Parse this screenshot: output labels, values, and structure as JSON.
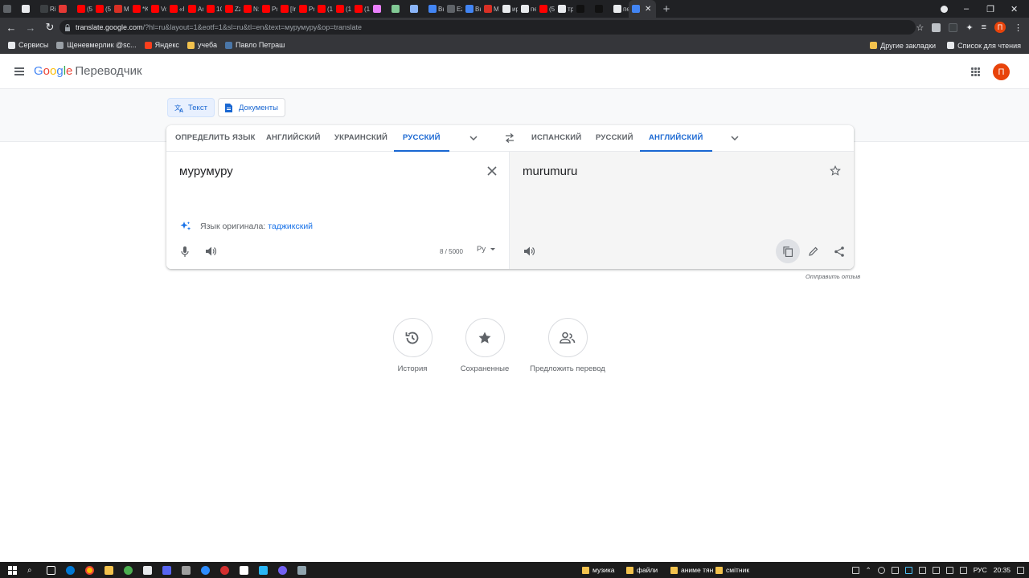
{
  "browser": {
    "tab_labels": [
      "",
      "",
      "Ri",
      "",
      "(5",
      "(5",
      "M",
      "*K",
      "Vo",
      "«I",
      "Ar",
      "1С",
      "Zz",
      "N:",
      "Pr",
      "[Ir",
      "Pr",
      "(1",
      "(1",
      "(1",
      "",
      "",
      "",
      "Вь",
      "Ez",
      "Вь",
      "М",
      "ир",
      "пе",
      "(5",
      "тр",
      "",
      "",
      "пе",
      ""
    ],
    "tab_colors": [
      "#5f6368",
      "#e8eaed",
      "#3c4043",
      "#e53935",
      "#ff0000",
      "#ff0000",
      "#d93025",
      "#ff0000",
      "#ff0000",
      "#ff0000",
      "#ff0000",
      "#ff0000",
      "#ff0000",
      "#ff0000",
      "#ff0000",
      "#ff0000",
      "#ff0000",
      "#ff0000",
      "#ff0000",
      "#ff0000",
      "#ea80fc",
      "#81c995",
      "#8ab4f8",
      "#4285f4",
      "#5f6368",
      "#4285f4",
      "#d93025",
      "#e8eaed",
      "#e8eaed",
      "#ff0000",
      "#e8eaed",
      "#111111",
      "#111111",
      "#e8eaed",
      "#4285f4"
    ],
    "url_host": "translate.google.com",
    "url_rest": "/?hl=ru&layout=1&eotf=1&sl=ru&tl=en&text=мурумуру&op=translate",
    "profile_initial": "П",
    "bookmarks": [
      {
        "label": "Сервисы",
        "color": "#e8eaed"
      },
      {
        "label": "Щеневмерлик @sc...",
        "color": "#9aa0a6"
      },
      {
        "label": "Яндекс",
        "color": "#fc3f1d"
      },
      {
        "label": "учеба",
        "color": "#f3c24d"
      },
      {
        "label": "Павло Петраш",
        "color": "#4a76a8"
      }
    ],
    "bookmarks_right": [
      {
        "label": "Другие закладки",
        "color": "#f3c24d"
      },
      {
        "label": "Список для чтения",
        "color": "#e8eaed"
      }
    ]
  },
  "header": {
    "logo_letters": [
      "G",
      "o",
      "o",
      "g",
      "l",
      "e"
    ],
    "product": "Переводчик",
    "avatar_initial": "П"
  },
  "modes": {
    "text": "Текст",
    "documents": "Документы"
  },
  "source_langs": [
    "Определить язык",
    "Английский",
    "Украинский",
    "Русский"
  ],
  "target_langs": [
    "Испанский",
    "Русский",
    "Английский"
  ],
  "source": {
    "text": "мурумуру",
    "detected_prefix": "Язык оригинала:",
    "detected_lang": "таджикский",
    "char_count": "8 / 5000",
    "keyboard": "Ру"
  },
  "target": {
    "text": "murumuru"
  },
  "feedback": "Отправить отзыв",
  "quick_actions": [
    {
      "label": "История",
      "icon": "history-icon"
    },
    {
      "label": "Сохраненные",
      "icon": "star-icon"
    },
    {
      "label": "Предложить перевод",
      "icon": "people-icon"
    }
  ],
  "taskbar": {
    "folders": [
      "музика",
      "файли",
      "аниме тян",
      "смітник"
    ],
    "lang": "РУС",
    "time": "20:35"
  }
}
